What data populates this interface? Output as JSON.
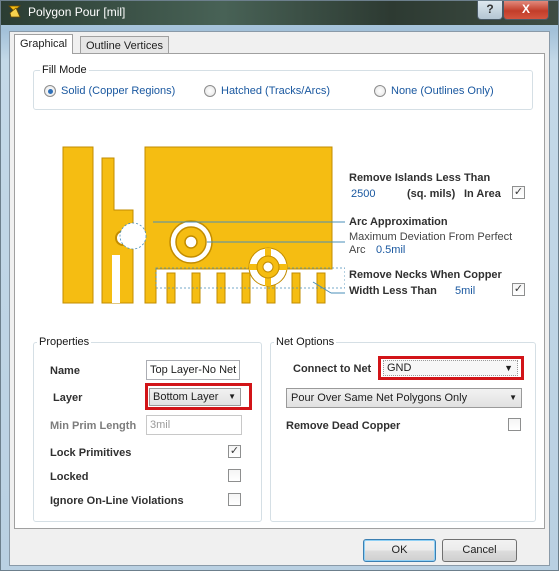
{
  "window": {
    "title": "Polygon Pour [mil]",
    "help_label": "?",
    "close_label": "X"
  },
  "tabs": [
    {
      "label": "Graphical"
    },
    {
      "label": "Outline Vertices"
    }
  ],
  "fill_mode": {
    "group_label": "Fill Mode",
    "options": [
      {
        "label": "Solid (Copper Regions)",
        "selected": true
      },
      {
        "label": "Hatched (Tracks/Arcs)",
        "selected": false
      },
      {
        "label": "None (Outlines Only)",
        "selected": false
      }
    ]
  },
  "diagram": {
    "remove_islands": {
      "title": "Remove Islands Less Than",
      "value": "2500",
      "unit": "(sq. mils)",
      "in_area_label": "In Area",
      "in_area_checked": true
    },
    "arc_approx": {
      "title": "Arc Approximation",
      "desc1": "Maximum Deviation From Perfect",
      "desc2": "Arc",
      "value": "0.5mil"
    },
    "remove_necks": {
      "title1": "Remove Necks When Copper",
      "title2": "Width Less Than",
      "value": "5mil",
      "checked": true
    }
  },
  "properties": {
    "group_label": "Properties",
    "name_label": "Name",
    "name_value": "Top Layer-No Net",
    "layer_label": "Layer",
    "layer_value": "Bottom Layer",
    "min_prim_label": "Min Prim Length",
    "min_prim_value": "3mil",
    "lock_primitives_label": "Lock Primitives",
    "lock_primitives_checked": true,
    "locked_label": "Locked",
    "locked_checked": false,
    "ignore_violations_label": "Ignore On-Line Violations",
    "ignore_violations_checked": false
  },
  "net_options": {
    "group_label": "Net Options",
    "connect_label": "Connect to Net",
    "connect_value": "GND",
    "pour_over_value": "Pour Over Same Net Polygons Only",
    "remove_dead_label": "Remove Dead Copper",
    "remove_dead_checked": false
  },
  "buttons": {
    "ok": "OK",
    "cancel": "Cancel"
  },
  "colors": {
    "copper": "#f5bd12",
    "accent_blue": "#1a58a0",
    "highlight_red": "#d21418"
  }
}
